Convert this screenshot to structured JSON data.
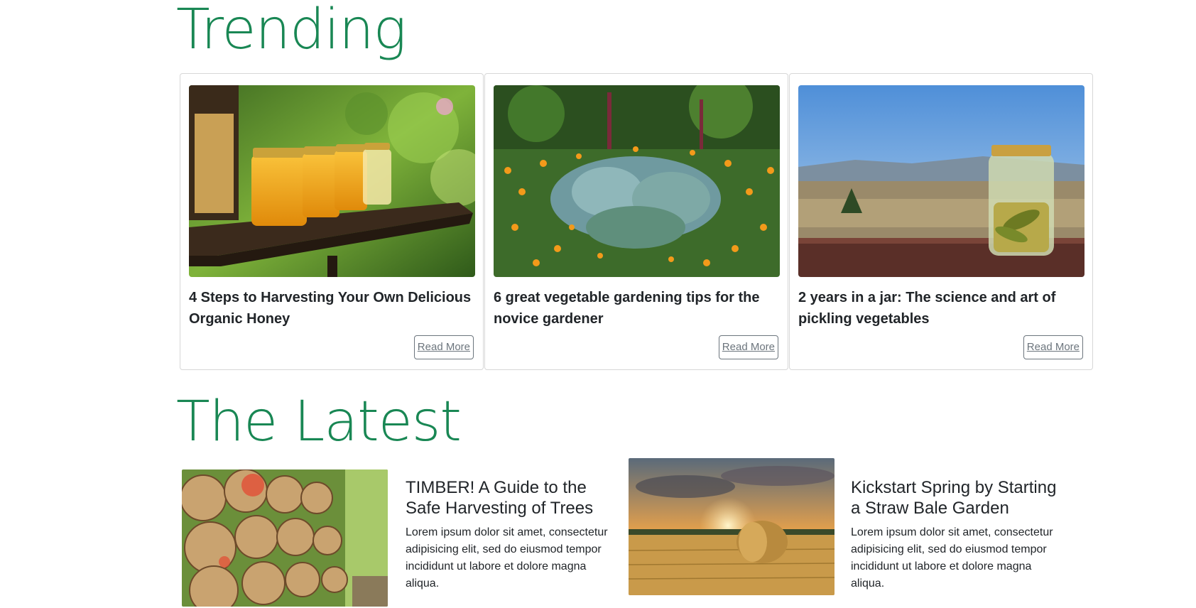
{
  "trending": {
    "heading": "Trending",
    "cards": [
      {
        "title": "4 Steps to Harvesting Your Own Delicious Organic Honey",
        "button": "Read More",
        "image": "honey-jars-photo"
      },
      {
        "title": "6 great vegetable gardening tips for the novice gardener",
        "button": "Read More",
        "image": "vegetable-garden-photo"
      },
      {
        "title": "2 years in a jar: The science and art of pickling vegetables",
        "button": "Read More",
        "image": "pickle-jar-photo"
      }
    ]
  },
  "latest": {
    "heading": "The Latest",
    "articles": [
      {
        "title": "TIMBER! A Guide to the Safe Harvesting of Trees",
        "body": "Lorem ipsum dolor sit amet, consectetur adipisicing elit, sed do eiusmod tempor incididunt ut labore et dolore magna aliqua.",
        "image": "log-pile-photo"
      },
      {
        "title": "Kickstart Spring by Starting a Straw Bale Garden",
        "body": "Lorem ipsum dolor sit amet, consectetur adipisicing elit, sed do eiusmod tempor incididunt ut labore et dolore magna aliqua.",
        "image": "hay-bale-field-photo"
      }
    ]
  },
  "colors": {
    "accent": "#198754",
    "button_border": "#6c757d",
    "card_border": "#d7d7d7"
  }
}
